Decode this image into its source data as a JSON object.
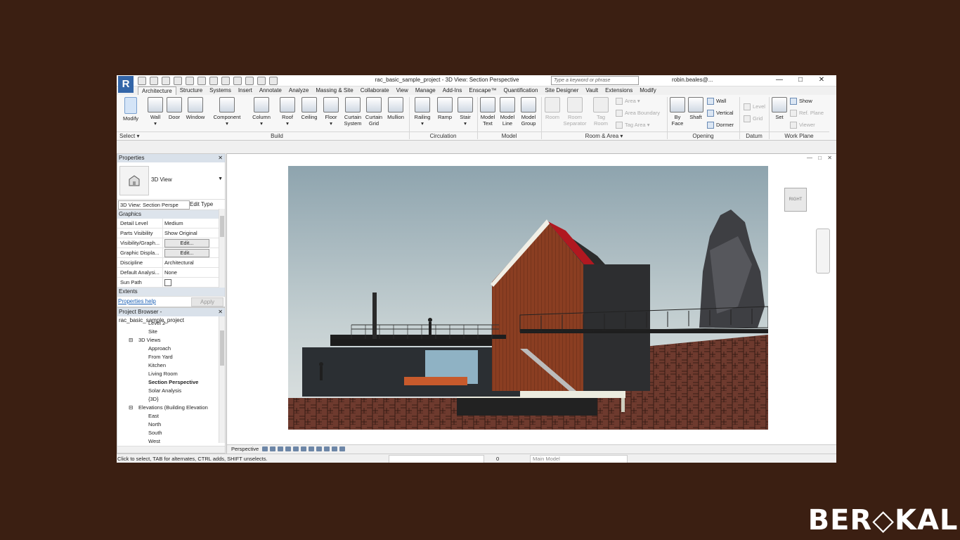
{
  "window": {
    "title": "rac_basic_sample_project - 3D View: Section Perspective",
    "search_placeholder": "Type a keyword or phrase",
    "user": "robin.beales@...",
    "controls": [
      "—",
      "□",
      "✕"
    ]
  },
  "tabs": [
    "Architecture",
    "Structure",
    "Systems",
    "Insert",
    "Annotate",
    "Analyze",
    "Massing & Site",
    "Collaborate",
    "View",
    "Manage",
    "Add-Ins",
    "Enscape™",
    "Quantification",
    "Site Designer",
    "Vault",
    "Extensions",
    "Modify"
  ],
  "ribbon": {
    "modify": "Modify",
    "select": "Select ▾",
    "build": [
      {
        "label": "Wall",
        "sub": "▾"
      },
      {
        "label": "Door",
        "sub": ""
      },
      {
        "label": "Window",
        "sub": ""
      },
      {
        "label": "Component",
        "sub": "▾"
      },
      {
        "label": "Column",
        "sub": "▾"
      },
      {
        "label": "Roof",
        "sub": "▾"
      },
      {
        "label": "Ceiling",
        "sub": ""
      },
      {
        "label": "Floor",
        "sub": "▾"
      },
      {
        "label": "Curtain",
        "sub": "System"
      },
      {
        "label": "Curtain",
        "sub": "Grid"
      },
      {
        "label": "Mullion",
        "sub": ""
      }
    ],
    "circulation": [
      {
        "label": "Railing",
        "sub": "▾"
      },
      {
        "label": "Ramp",
        "sub": ""
      },
      {
        "label": "Stair",
        "sub": "▾"
      }
    ],
    "model": [
      {
        "label": "Model",
        "sub": "Text"
      },
      {
        "label": "Model",
        "sub": "Line"
      },
      {
        "label": "Model",
        "sub": "Group"
      }
    ],
    "room": [
      {
        "label": "Room",
        "sub": ""
      },
      {
        "label": "Room",
        "sub": "Separator"
      },
      {
        "label": "Tag",
        "sub": "Room"
      }
    ],
    "room_small": [
      "Area ▾",
      "Area Boundary",
      "Tag Area ▾"
    ],
    "opening": [
      {
        "label": "By",
        "sub": "Face"
      },
      {
        "label": "Shaft",
        "sub": ""
      }
    ],
    "opening_small": [
      "Wall",
      "Vertical",
      "Dormer"
    ],
    "datum_small": [
      "Level",
      "Grid"
    ],
    "workplane": {
      "label": "Set",
      "small": [
        "Show",
        "Ref. Plane",
        "Viewer"
      ]
    },
    "panels": [
      "Build",
      "Circulation",
      "Model",
      "Room & Area ▾",
      "Opening",
      "Datum",
      "Work Plane"
    ]
  },
  "properties": {
    "title": "Properties",
    "type_name": "3D View",
    "selector": "3D View: Section Perspe",
    "edit_type": "Edit Type",
    "group_graphics": "Graphics",
    "rows": [
      {
        "k": "Detail Level",
        "v": "Medium"
      },
      {
        "k": "Parts Visibility",
        "v": "Show Original"
      },
      {
        "k": "Visibility/Graph...",
        "v": "Edit..."
      },
      {
        "k": "Graphic Displa...",
        "v": "Edit..."
      },
      {
        "k": "Discipline",
        "v": "Architectural"
      },
      {
        "k": "Default Analysi...",
        "v": "None"
      },
      {
        "k": "Sun Path",
        "v": ""
      }
    ],
    "group_extents": "Extents",
    "help": "Properties help",
    "apply": "Apply"
  },
  "browser": {
    "title": "Project Browser - rac_basic_sample_project",
    "items": [
      {
        "label": "Level 2",
        "level": 3
      },
      {
        "label": "Site",
        "level": 3
      },
      {
        "label": "3D Views",
        "level": 2
      },
      {
        "label": "Approach",
        "level": 3
      },
      {
        "label": "From Yard",
        "level": 3
      },
      {
        "label": "Kitchen",
        "level": 3
      },
      {
        "label": "Living Room",
        "level": 3
      },
      {
        "label": "Section Perspective",
        "level": 3
      },
      {
        "label": "Solar Analysis",
        "level": 3
      },
      {
        "label": "{3D}",
        "level": 3
      },
      {
        "label": "Elevations (Building Elevation",
        "level": 2
      },
      {
        "label": "East",
        "level": 3
      },
      {
        "label": "North",
        "level": 3
      },
      {
        "label": "South",
        "level": 3
      },
      {
        "label": "West",
        "level": 3
      }
    ]
  },
  "view": {
    "cube_label": "RIGHT",
    "bottom_label": "Perspective"
  },
  "status": {
    "message": "Click to select, TAB for alternates, CTRL adds, SHIFT unselects.",
    "zero": "0",
    "model": "Main Model"
  },
  "brand": "BER◇KAL"
}
